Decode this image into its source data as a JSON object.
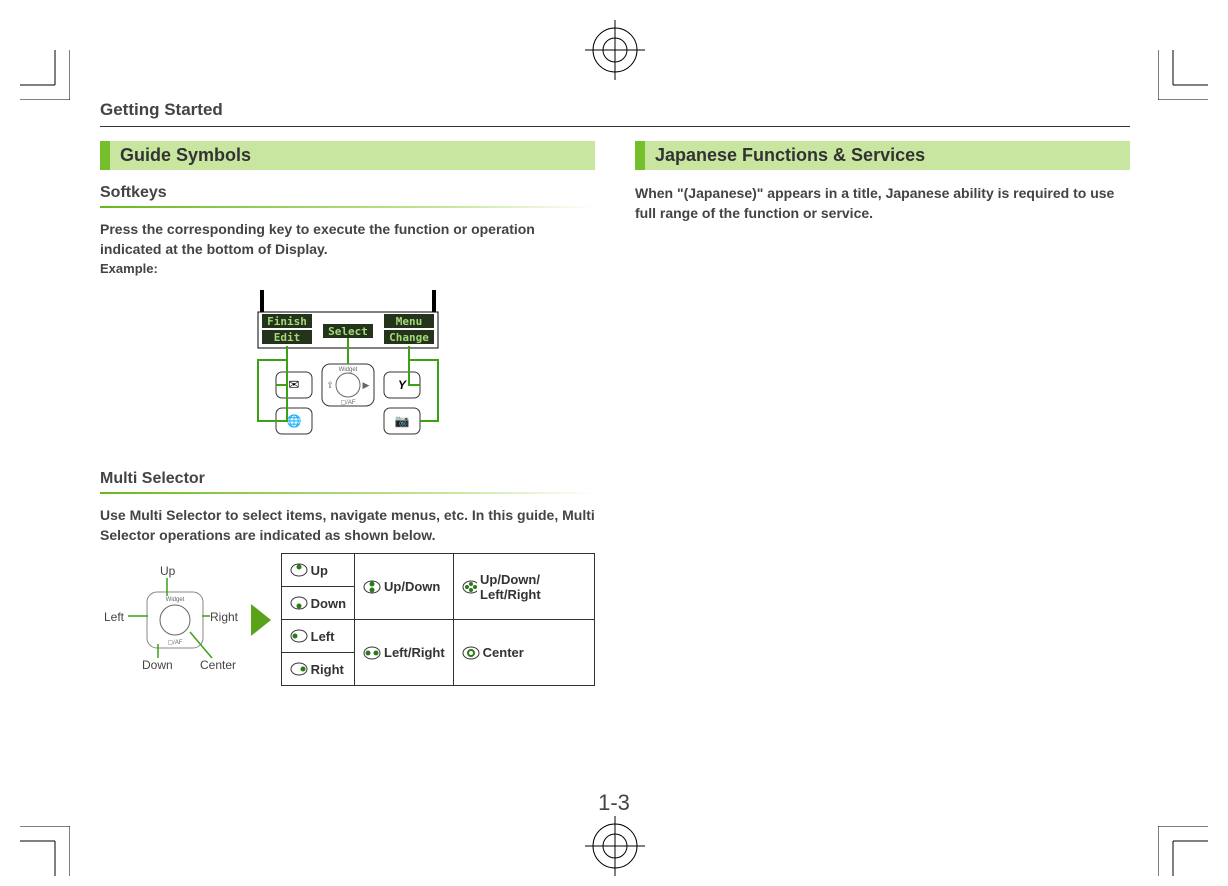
{
  "header": "Getting Started",
  "section1": {
    "title": "Guide Symbols",
    "sub1_title": "Softkeys",
    "sub1_body": "Press the corresponding key to execute the function or operation indicated at the bottom of Display.",
    "example_label": "Example:",
    "softkey_strip": {
      "left_top": "Finish",
      "left_bottom": "Edit",
      "center": "Select",
      "right_top": "Menu",
      "right_bottom": "Change",
      "pad_top": "Widget",
      "pad_bottom": "▢/AF"
    },
    "sub2_title": "Multi Selector",
    "sub2_body": "Use Multi Selector to select items, navigate menus, etc. In this guide, Multi Selector operations are indicated as shown below.",
    "dpad_labels": {
      "up": "Up",
      "left": "Left",
      "right": "Right",
      "down": "Down",
      "center": "Center",
      "pad_top": "Widget",
      "pad_bottom": "▢/AF"
    },
    "selector_table": {
      "up": "Up",
      "down": "Down",
      "left": "Left",
      "right": "Right",
      "updown": "Up/Down",
      "leftright": "Left/Right",
      "udlr": "Up/Down/ Left/Right",
      "center": "Center"
    }
  },
  "section2": {
    "title": "Japanese Functions & Services",
    "body": "When \"(Japanese)\" appears in a title, Japanese ability is required to use full range of the function or service."
  },
  "page_number": "1-3"
}
